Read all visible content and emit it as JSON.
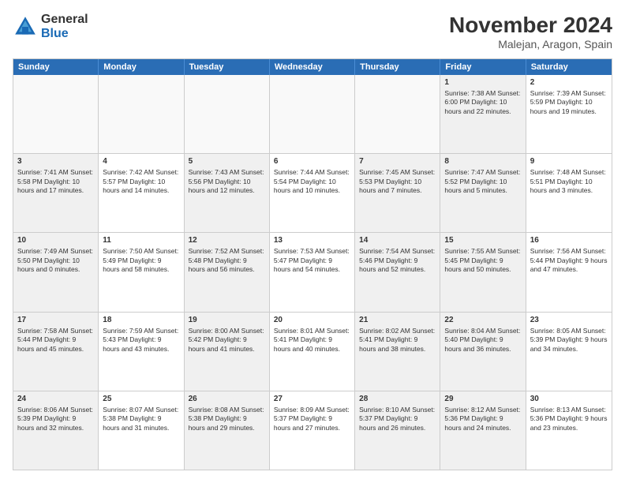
{
  "header": {
    "logo": {
      "general": "General",
      "blue": "Blue"
    },
    "title": "November 2024",
    "subtitle": "Malejan, Aragon, Spain"
  },
  "weekdays": [
    "Sunday",
    "Monday",
    "Tuesday",
    "Wednesday",
    "Thursday",
    "Friday",
    "Saturday"
  ],
  "rows": [
    [
      {
        "day": "",
        "info": "",
        "empty": true
      },
      {
        "day": "",
        "info": "",
        "empty": true
      },
      {
        "day": "",
        "info": "",
        "empty": true
      },
      {
        "day": "",
        "info": "",
        "empty": true
      },
      {
        "day": "",
        "info": "",
        "empty": true
      },
      {
        "day": "1",
        "info": "Sunrise: 7:38 AM\nSunset: 6:00 PM\nDaylight: 10 hours\nand 22 minutes.",
        "shaded": true
      },
      {
        "day": "2",
        "info": "Sunrise: 7:39 AM\nSunset: 5:59 PM\nDaylight: 10 hours\nand 19 minutes."
      }
    ],
    [
      {
        "day": "3",
        "info": "Sunrise: 7:41 AM\nSunset: 5:58 PM\nDaylight: 10 hours\nand 17 minutes.",
        "shaded": true
      },
      {
        "day": "4",
        "info": "Sunrise: 7:42 AM\nSunset: 5:57 PM\nDaylight: 10 hours\nand 14 minutes."
      },
      {
        "day": "5",
        "info": "Sunrise: 7:43 AM\nSunset: 5:56 PM\nDaylight: 10 hours\nand 12 minutes.",
        "shaded": true
      },
      {
        "day": "6",
        "info": "Sunrise: 7:44 AM\nSunset: 5:54 PM\nDaylight: 10 hours\nand 10 minutes."
      },
      {
        "day": "7",
        "info": "Sunrise: 7:45 AM\nSunset: 5:53 PM\nDaylight: 10 hours\nand 7 minutes.",
        "shaded": true
      },
      {
        "day": "8",
        "info": "Sunrise: 7:47 AM\nSunset: 5:52 PM\nDaylight: 10 hours\nand 5 minutes.",
        "shaded": true
      },
      {
        "day": "9",
        "info": "Sunrise: 7:48 AM\nSunset: 5:51 PM\nDaylight: 10 hours\nand 3 minutes."
      }
    ],
    [
      {
        "day": "10",
        "info": "Sunrise: 7:49 AM\nSunset: 5:50 PM\nDaylight: 10 hours\nand 0 minutes.",
        "shaded": true
      },
      {
        "day": "11",
        "info": "Sunrise: 7:50 AM\nSunset: 5:49 PM\nDaylight: 9 hours\nand 58 minutes."
      },
      {
        "day": "12",
        "info": "Sunrise: 7:52 AM\nSunset: 5:48 PM\nDaylight: 9 hours\nand 56 minutes.",
        "shaded": true
      },
      {
        "day": "13",
        "info": "Sunrise: 7:53 AM\nSunset: 5:47 PM\nDaylight: 9 hours\nand 54 minutes."
      },
      {
        "day": "14",
        "info": "Sunrise: 7:54 AM\nSunset: 5:46 PM\nDaylight: 9 hours\nand 52 minutes.",
        "shaded": true
      },
      {
        "day": "15",
        "info": "Sunrise: 7:55 AM\nSunset: 5:45 PM\nDaylight: 9 hours\nand 50 minutes.",
        "shaded": true
      },
      {
        "day": "16",
        "info": "Sunrise: 7:56 AM\nSunset: 5:44 PM\nDaylight: 9 hours\nand 47 minutes."
      }
    ],
    [
      {
        "day": "17",
        "info": "Sunrise: 7:58 AM\nSunset: 5:44 PM\nDaylight: 9 hours\nand 45 minutes.",
        "shaded": true
      },
      {
        "day": "18",
        "info": "Sunrise: 7:59 AM\nSunset: 5:43 PM\nDaylight: 9 hours\nand 43 minutes."
      },
      {
        "day": "19",
        "info": "Sunrise: 8:00 AM\nSunset: 5:42 PM\nDaylight: 9 hours\nand 41 minutes.",
        "shaded": true
      },
      {
        "day": "20",
        "info": "Sunrise: 8:01 AM\nSunset: 5:41 PM\nDaylight: 9 hours\nand 40 minutes."
      },
      {
        "day": "21",
        "info": "Sunrise: 8:02 AM\nSunset: 5:41 PM\nDaylight: 9 hours\nand 38 minutes.",
        "shaded": true
      },
      {
        "day": "22",
        "info": "Sunrise: 8:04 AM\nSunset: 5:40 PM\nDaylight: 9 hours\nand 36 minutes.",
        "shaded": true
      },
      {
        "day": "23",
        "info": "Sunrise: 8:05 AM\nSunset: 5:39 PM\nDaylight: 9 hours\nand 34 minutes."
      }
    ],
    [
      {
        "day": "24",
        "info": "Sunrise: 8:06 AM\nSunset: 5:39 PM\nDaylight: 9 hours\nand 32 minutes.",
        "shaded": true
      },
      {
        "day": "25",
        "info": "Sunrise: 8:07 AM\nSunset: 5:38 PM\nDaylight: 9 hours\nand 31 minutes."
      },
      {
        "day": "26",
        "info": "Sunrise: 8:08 AM\nSunset: 5:38 PM\nDaylight: 9 hours\nand 29 minutes.",
        "shaded": true
      },
      {
        "day": "27",
        "info": "Sunrise: 8:09 AM\nSunset: 5:37 PM\nDaylight: 9 hours\nand 27 minutes."
      },
      {
        "day": "28",
        "info": "Sunrise: 8:10 AM\nSunset: 5:37 PM\nDaylight: 9 hours\nand 26 minutes.",
        "shaded": true
      },
      {
        "day": "29",
        "info": "Sunrise: 8:12 AM\nSunset: 5:36 PM\nDaylight: 9 hours\nand 24 minutes.",
        "shaded": true
      },
      {
        "day": "30",
        "info": "Sunrise: 8:13 AM\nSunset: 5:36 PM\nDaylight: 9 hours\nand 23 minutes."
      }
    ]
  ]
}
